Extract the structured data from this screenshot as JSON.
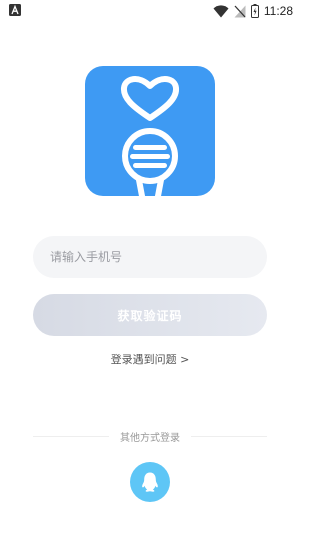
{
  "status_bar": {
    "left_icon": "a-notification-icon",
    "icons": [
      "wifi-icon",
      "signal-off-icon",
      "battery-charging-icon"
    ],
    "time": "11:28"
  },
  "app": {
    "logo_icon": "heart-microphone-logo",
    "brand_color": "#3e9af3"
  },
  "login": {
    "phone_placeholder": "请输入手机号",
    "phone_value": "",
    "get_code_label": "获取验证码",
    "trouble_label": "登录遇到问题 >"
  },
  "other_login": {
    "label": "其他方式登录",
    "qq_icon": "qq-penguin-icon",
    "qq_color": "#5ec6f6"
  }
}
